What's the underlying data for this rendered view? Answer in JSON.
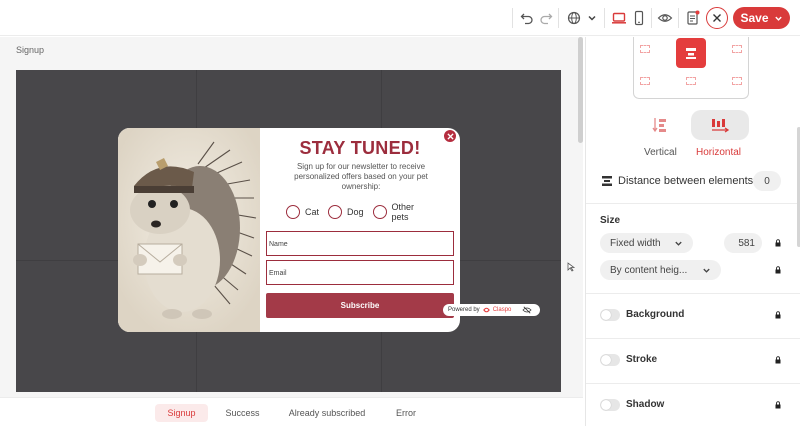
{
  "toolbar": {
    "save_label": "Save",
    "icons": [
      "undo-icon",
      "redo-icon",
      "globe-icon",
      "chevron-down-icon",
      "desktop-icon",
      "mobile-icon",
      "eye-icon",
      "document-alert-icon",
      "close-icon"
    ],
    "accent": "#d93a3a"
  },
  "canvas": {
    "breadcrumb": "Signup"
  },
  "popup": {
    "title": "STAY TUNED!",
    "subtitle": "Sign up for our newsletter to receive personalized offers based on your pet ownership:",
    "options": [
      "Cat",
      "Dog",
      "Other pets"
    ],
    "name_placeholder": "Name",
    "email_placeholder": "Email",
    "subscribe_label": "Subscribe",
    "powered_by": "Powered by",
    "brand": "Claspo",
    "brand_color": "#9c2d3d"
  },
  "tabs": [
    {
      "label": "Signup",
      "active": true
    },
    {
      "label": "Success",
      "active": false
    },
    {
      "label": "Already subscribed",
      "active": false
    },
    {
      "label": "Error",
      "active": false
    }
  ],
  "panel": {
    "orientation": {
      "vertical_label": "Vertical",
      "horizontal_label": "Horizontal",
      "selected": "Horizontal"
    },
    "distance": {
      "label": "Distance between elements",
      "value": "0"
    },
    "size": {
      "title": "Size",
      "width_mode": "Fixed width",
      "width_value": "581",
      "height_mode": "By content heig..."
    },
    "sections": [
      {
        "title": "Background",
        "enabled": false
      },
      {
        "title": "Stroke",
        "enabled": false
      },
      {
        "title": "Shadow",
        "enabled": false
      }
    ]
  }
}
